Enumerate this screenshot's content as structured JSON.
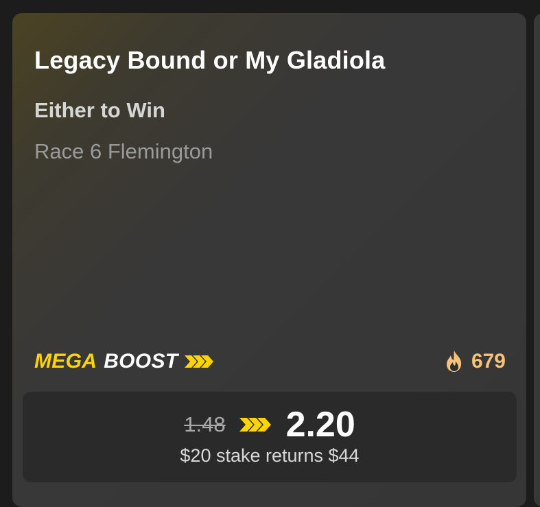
{
  "selection": {
    "title": "Legacy Bound or My Gladiola",
    "market": "Either to Win",
    "race": "Race 6 Flemington"
  },
  "boost": {
    "mega_label": "MEGA",
    "boost_label": "BOOST",
    "chevron_icon": "triple-chevron-right-icon",
    "accent_color": "#ffd400"
  },
  "popularity": {
    "icon": "fire-icon",
    "count": "679",
    "color": "#f6c27a"
  },
  "odds": {
    "old": "1.48",
    "new": "2.20",
    "returns_text": "$20 stake returns $44"
  }
}
